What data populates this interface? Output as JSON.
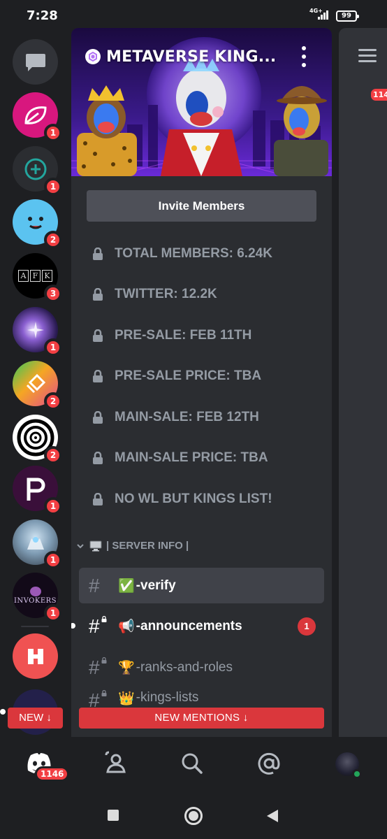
{
  "status_bar": {
    "time": "7:28",
    "network": "4G+",
    "battery": "99"
  },
  "server": {
    "name": "METAVERSE KING...",
    "invite_label": "Invite Members"
  },
  "stats": [
    {
      "label": "TOTAL MEMBERS: 6.24K"
    },
    {
      "label": "TWITTER: 12.2K"
    },
    {
      "label": "PRE-SALE: FEB 11TH"
    },
    {
      "label": "PRE-SALE PRICE: TBA"
    },
    {
      "label": "MAIN-SALE: FEB 12TH"
    },
    {
      "label": "MAIN-SALE PRICE: TBA"
    },
    {
      "label": "NO WL BUT KINGS LIST!"
    }
  ],
  "category": {
    "name": "| SERVER INFO |",
    "icon": "monitor-icon"
  },
  "channels": [
    {
      "emoji": "✅",
      "name": "-verify",
      "state": "active"
    },
    {
      "emoji": "📢",
      "name": "-announcements",
      "state": "unread",
      "mentions": "1",
      "locked": true
    },
    {
      "emoji": "🏆",
      "name": "-ranks-and-roles",
      "state": "read",
      "locked": true
    },
    {
      "emoji": "👑",
      "name": "-kings-lists",
      "state": "read",
      "locked": true
    }
  ],
  "rail_badges": [
    "1",
    "1",
    "2",
    "3",
    "1",
    "2",
    "2",
    "1",
    "1",
    "1"
  ],
  "rail_avatar_texts": {
    "afk": "AFK",
    "invokers": "INVOKERS"
  },
  "new_mentions_label": "NEW MENTIONS ↓",
  "new_label": "NEW ↓",
  "peek_badge": "1146",
  "tabbar": {
    "home_badge": "1146"
  },
  "colors": {
    "accent": "#da373c",
    "background": "#2b2d31",
    "rail": "#1e1f22"
  }
}
